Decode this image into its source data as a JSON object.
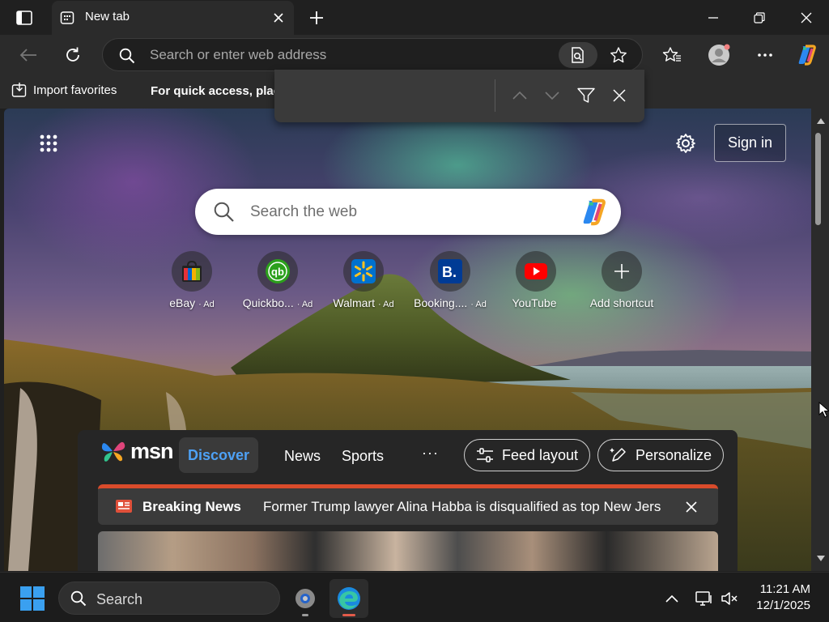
{
  "colors": {
    "chrome": "#202020",
    "toolbar": "#2b2b2b",
    "accent_blue": "#4ea1f5",
    "breaking_red": "#d94b2b"
  },
  "tab": {
    "title": "New tab",
    "favicon": "new-tab-icon"
  },
  "toolbar": {
    "address_placeholder": "Search or enter web address"
  },
  "favorites_bar": {
    "import_label": "Import favorites",
    "hint": "For quick access, place your favorites here on the favorites bar."
  },
  "findbar": {
    "query": ""
  },
  "newtab": {
    "signin_label": "Sign in",
    "search_placeholder": "Search the web",
    "shortcuts": [
      {
        "label": "eBay",
        "ad": "· Ad",
        "icon": "ebay-icon"
      },
      {
        "label": "Quickbo...",
        "ad": "· Ad",
        "icon": "quickbooks-icon"
      },
      {
        "label": "Walmart",
        "ad": "· Ad",
        "icon": "walmart-icon"
      },
      {
        "label": "Booking....",
        "ad": "· Ad",
        "icon": "booking-icon"
      },
      {
        "label": "YouTube",
        "ad": "",
        "icon": "youtube-icon"
      },
      {
        "label": "Add shortcut",
        "ad": "",
        "icon": "plus-icon"
      }
    ]
  },
  "feed": {
    "brand": "msn",
    "tabs": {
      "discover": "Discover",
      "news": "News",
      "sports": "Sports",
      "more": "···"
    },
    "feed_layout_label": "Feed layout",
    "personalize_label": "Personalize",
    "breaking": {
      "label": "Breaking News",
      "headline": "Former Trump lawyer Alina Habba is disqualified as top New Jersey federal prosecutor"
    }
  },
  "taskbar": {
    "search_label": "Search",
    "time": "11:21 AM",
    "date": "12/1/2025"
  }
}
